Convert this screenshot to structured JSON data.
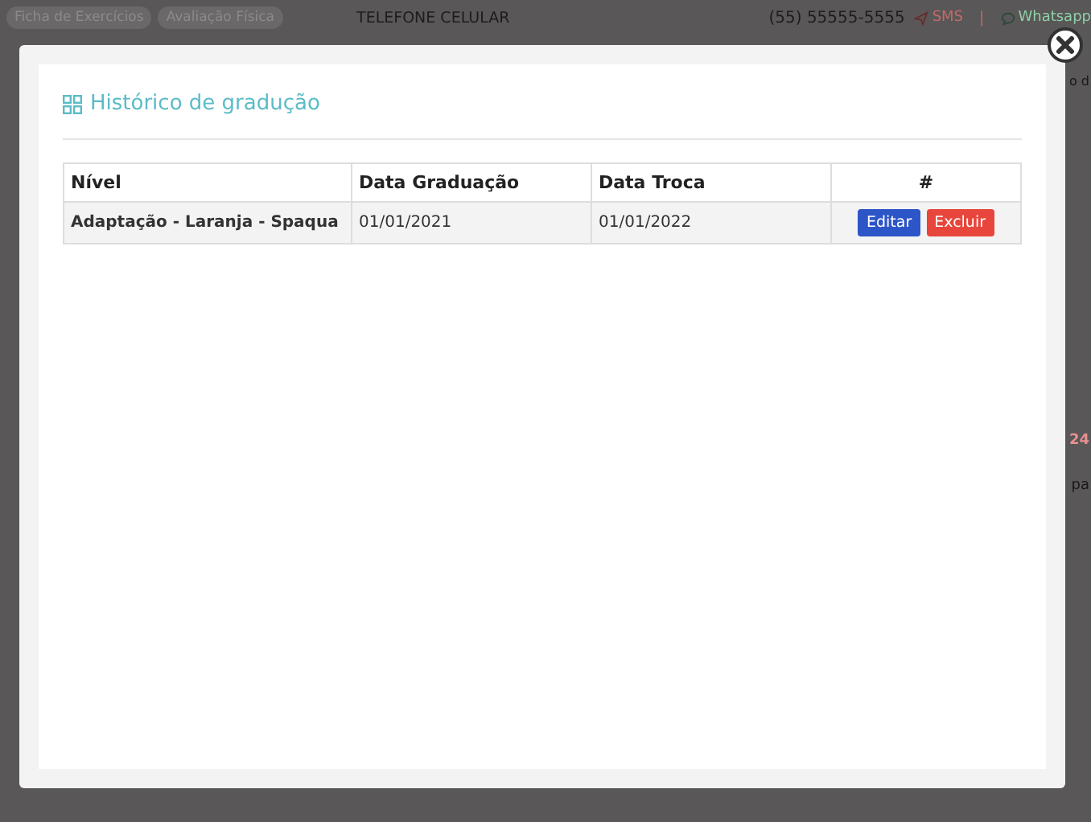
{
  "background_page": {
    "tab_buttons": [
      "Ficha de Exercícios",
      "Avaliação Física"
    ],
    "phone_label": "TELEFONE CELULAR",
    "phone_number": "(55) 55555-5555",
    "sms_link": "SMS",
    "separator": "|",
    "whatsapp_link": "Whatsapp",
    "right_fragments": [
      "o d",
      "24",
      "pa"
    ]
  },
  "modal": {
    "title": "Histórico de gradução",
    "table": {
      "columns": [
        "Nível",
        "Data Graduação",
        "Data Troca",
        "#"
      ],
      "rows": [
        {
          "cells": [
            "Adaptação - Laranja - Spaqua",
            "01/01/2021",
            "01/01/2022"
          ],
          "actions": [
            {
              "label": "Editar",
              "kind": "edit"
            },
            {
              "label": "Excluir",
              "kind": "delete"
            }
          ]
        }
      ]
    }
  }
}
